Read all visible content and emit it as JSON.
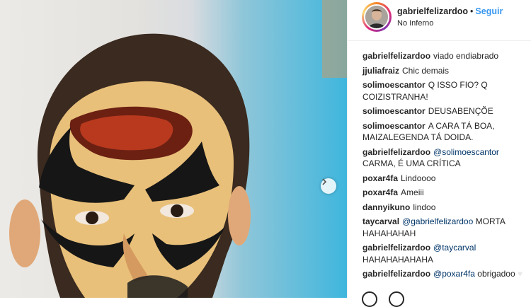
{
  "post": {
    "username": "gabrielfelizardoo",
    "separator": "•",
    "follow_label": "Seguir",
    "location": "No Inferno"
  },
  "comments": [
    {
      "user": "gabrielfelizardoo",
      "text": "viado endiabrado"
    },
    {
      "user": "jjuliafraiz",
      "text": "Chic demais"
    },
    {
      "user": "solimoescantor",
      "text": "Q ISSO FIO? Q COIZISTRANHA!"
    },
    {
      "user": "solimoescantor",
      "text": "DEUSABENÇÕE"
    },
    {
      "user": "solimoescantor",
      "text": "A CARA TÁ BOA, MAIZALEGENDA TÁ DOIDA."
    },
    {
      "user": "gabrielfelizardoo",
      "mention": "@solimoescantor",
      "text": "CARMA, É UMA CRÍTICA"
    },
    {
      "user": "poxar4fa",
      "text": "Lindoooo"
    },
    {
      "user": "poxar4fa",
      "text": "Ameiii"
    },
    {
      "user": "dannyikuno",
      "text": "lindoo"
    },
    {
      "user": "taycarval",
      "mention": "@gabrielfelizardoo",
      "text": "MORTA HAHAHAHAH"
    },
    {
      "user": "gabrielfelizardoo",
      "mention": "@taycarval",
      "text": "HAHAHAHAHAHA"
    },
    {
      "user": "gabrielfelizardoo",
      "mention": "@poxar4fa",
      "text": "obrigadoo"
    }
  ],
  "icons": {
    "next": "chevron-right-icon",
    "heart": "heart-icon",
    "follow_color": "#3897f0"
  }
}
